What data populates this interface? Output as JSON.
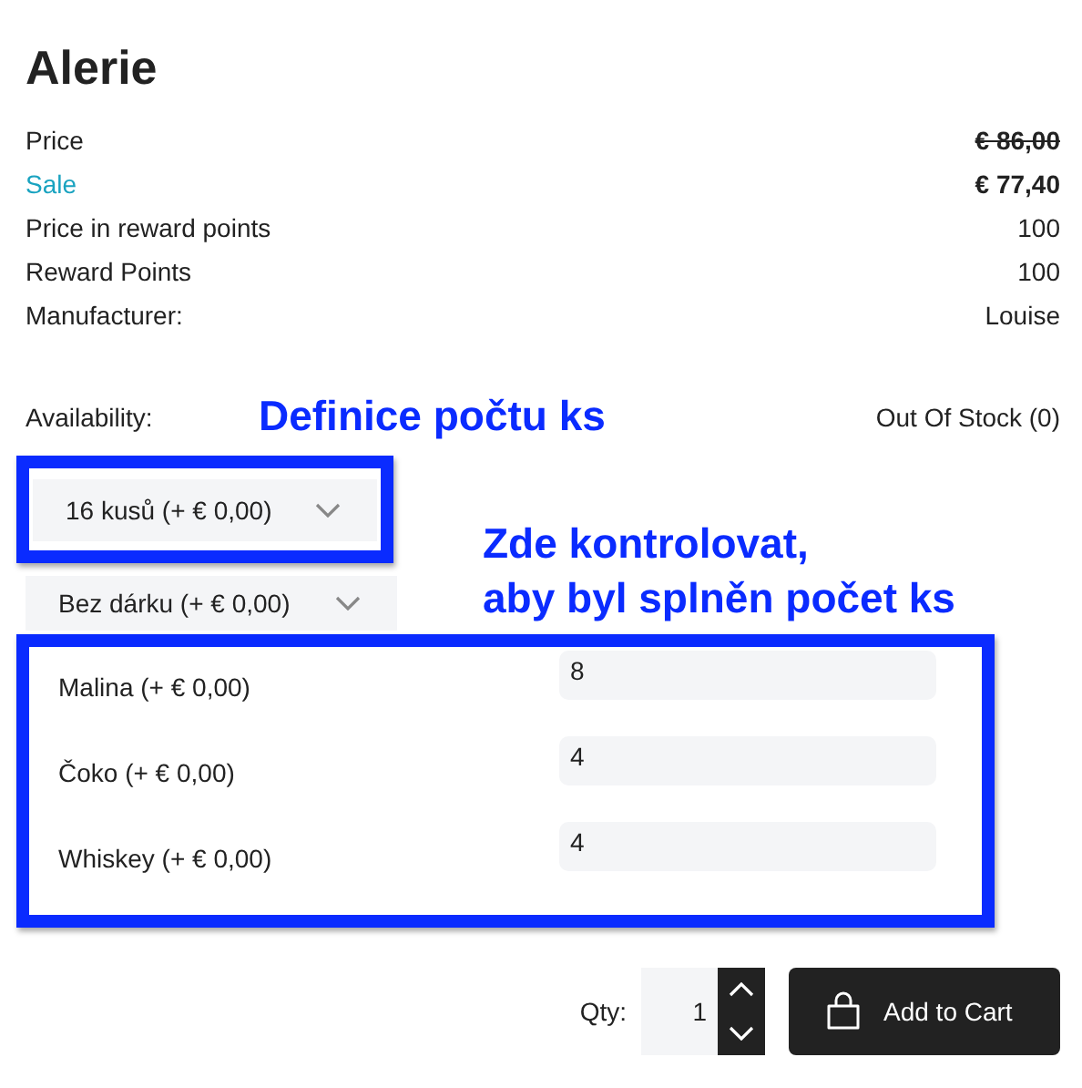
{
  "product": {
    "title": "Alerie"
  },
  "details": [
    {
      "label": "Price",
      "value": "€ 86,00",
      "kind": "old"
    },
    {
      "label": "Sale",
      "value": "€ 77,40",
      "kind": "sale"
    },
    {
      "label": "Price in reward points",
      "value": "100",
      "kind": "plain"
    },
    {
      "label": "Reward Points",
      "value": "100",
      "kind": "plain"
    },
    {
      "label": "Manufacturer:",
      "value": "Louise",
      "kind": "plain"
    }
  ],
  "availability": {
    "label": "Availability:",
    "value": "Out Of Stock (0)"
  },
  "selects": [
    {
      "value": "16 kusů (+ € 0,00)"
    },
    {
      "value": "Bez dárku (+ € 0,00)"
    }
  ],
  "options": [
    {
      "label": "Malina (+ € 0,00)",
      "value": "8"
    },
    {
      "label": "Čoko (+ € 0,00)",
      "value": "4"
    },
    {
      "label": "Whiskey (+ € 0,00)",
      "value": "4"
    }
  ],
  "quantity": {
    "label": "Qty:",
    "value": "1"
  },
  "add_to_cart": {
    "label": "Add to Cart"
  },
  "annotations": [
    {
      "lines": [
        "Definice počtu ks"
      ]
    },
    {
      "lines": [
        "Zde kontrolovat,",
        "aby byl splněn počet ks"
      ]
    }
  ]
}
